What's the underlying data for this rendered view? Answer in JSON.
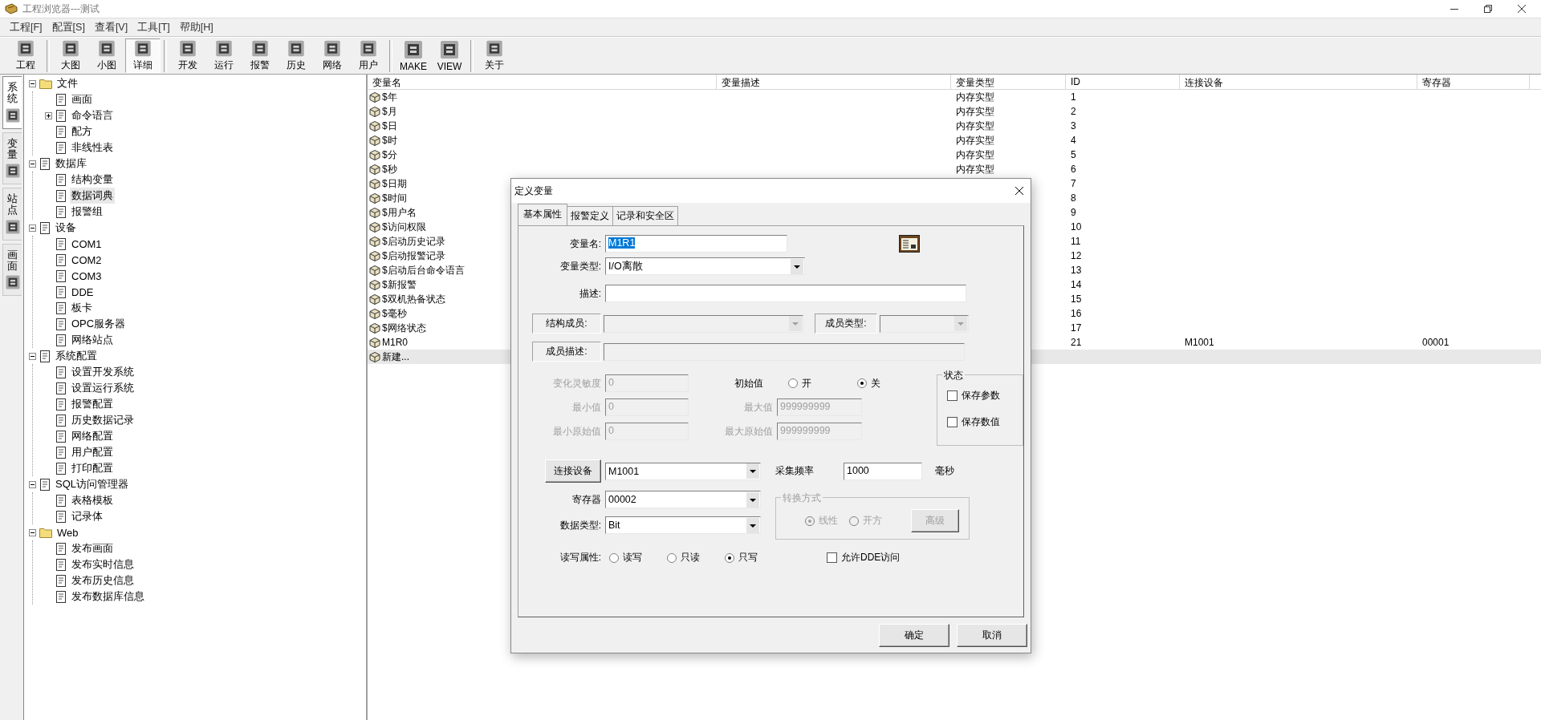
{
  "window": {
    "title": "工程浏览器---测试"
  },
  "menu": [
    "工程[F]",
    "配置[S]",
    "查看[V]",
    "工具[T]",
    "帮助[H]"
  ],
  "toolbar": {
    "groups": [
      [
        {
          "label": "工程",
          "selected": false
        }
      ],
      [
        {
          "label": "大图",
          "selected": false
        },
        {
          "label": "小图",
          "selected": false
        },
        {
          "label": "详细",
          "selected": true
        }
      ],
      [
        {
          "label": "开发",
          "selected": false
        },
        {
          "label": "运行",
          "selected": false
        },
        {
          "label": "报警",
          "selected": false
        },
        {
          "label": "历史",
          "selected": false
        },
        {
          "label": "网络",
          "selected": false
        },
        {
          "label": "用户",
          "selected": false
        }
      ],
      [
        {
          "label": "MAKE",
          "selected": false
        },
        {
          "label": "VIEW",
          "selected": false
        }
      ],
      [
        {
          "label": "关于",
          "selected": false
        }
      ]
    ]
  },
  "side_tabs": [
    {
      "label": "系统",
      "selected": true
    },
    {
      "label": "变量",
      "selected": false
    },
    {
      "label": "站点",
      "selected": false
    },
    {
      "label": "画面",
      "selected": false
    }
  ],
  "tree": [
    {
      "label": "文件",
      "kind": "folder",
      "expanded": true,
      "selected": false,
      "children": [
        {
          "label": "画面",
          "kind": "item",
          "selected": false
        },
        {
          "label": "命令语言",
          "kind": "item",
          "expanded": false,
          "selected": false
        },
        {
          "label": "配方",
          "kind": "item",
          "selected": false
        },
        {
          "label": "非线性表",
          "kind": "item",
          "selected": false
        }
      ]
    },
    {
      "label": "数据库",
      "kind": "item",
      "expanded": true,
      "selected": false,
      "children": [
        {
          "label": "结构变量",
          "kind": "item",
          "selected": false
        },
        {
          "label": "数据词典",
          "kind": "item",
          "selected": true
        },
        {
          "label": "报警组",
          "kind": "item",
          "selected": false
        }
      ]
    },
    {
      "label": "设备",
      "kind": "item",
      "expanded": true,
      "selected": false,
      "children": [
        {
          "label": "COM1",
          "kind": "item",
          "selected": false
        },
        {
          "label": "COM2",
          "kind": "item",
          "selected": false
        },
        {
          "label": "COM3",
          "kind": "item",
          "selected": false
        },
        {
          "label": "DDE",
          "kind": "item",
          "selected": false
        },
        {
          "label": "板卡",
          "kind": "item",
          "selected": false
        },
        {
          "label": "OPC服务器",
          "kind": "item",
          "selected": false
        },
        {
          "label": "网络站点",
          "kind": "item",
          "selected": false
        }
      ]
    },
    {
      "label": "系统配置",
      "kind": "item",
      "expanded": true,
      "selected": false,
      "children": [
        {
          "label": "设置开发系统",
          "kind": "item",
          "selected": false
        },
        {
          "label": "设置运行系统",
          "kind": "item",
          "selected": false
        },
        {
          "label": "报警配置",
          "kind": "item",
          "selected": false
        },
        {
          "label": "历史数据记录",
          "kind": "item",
          "selected": false
        },
        {
          "label": "网络配置",
          "kind": "item",
          "selected": false
        },
        {
          "label": "用户配置",
          "kind": "item",
          "selected": false
        },
        {
          "label": "打印配置",
          "kind": "item",
          "selected": false
        }
      ]
    },
    {
      "label": "SQL访问管理器",
      "kind": "item",
      "expanded": true,
      "selected": false,
      "children": [
        {
          "label": "表格模板",
          "kind": "item",
          "selected": false
        },
        {
          "label": "记录体",
          "kind": "item",
          "selected": false
        }
      ]
    },
    {
      "label": "Web",
      "kind": "folder",
      "expanded": true,
      "selected": false,
      "children": [
        {
          "label": "发布画面",
          "kind": "item",
          "selected": false
        },
        {
          "label": "发布实时信息",
          "kind": "item",
          "selected": false
        },
        {
          "label": "发布历史信息",
          "kind": "item",
          "selected": false
        },
        {
          "label": "发布数据库信息",
          "kind": "item",
          "selected": false
        }
      ]
    }
  ],
  "table": {
    "columns": [
      "变量名",
      "变量描述",
      "变量类型",
      "ID",
      "连接设备",
      "寄存器"
    ],
    "rows": [
      {
        "name": "$年",
        "type": "内存实型",
        "id": "1",
        "selected": false
      },
      {
        "name": "$月",
        "type": "内存实型",
        "id": "2",
        "selected": false
      },
      {
        "name": "$日",
        "type": "内存实型",
        "id": "3",
        "selected": false
      },
      {
        "name": "$时",
        "type": "内存实型",
        "id": "4",
        "selected": false
      },
      {
        "name": "$分",
        "type": "内存实型",
        "id": "5",
        "selected": false
      },
      {
        "name": "$秒",
        "type": "内存实型",
        "id": "6",
        "selected": false
      },
      {
        "name": "$日期",
        "id": "7",
        "selected": false
      },
      {
        "name": "$时间",
        "id": "8",
        "selected": false
      },
      {
        "name": "$用户名",
        "id": "9",
        "selected": false
      },
      {
        "name": "$访问权限",
        "id": "10",
        "selected": false
      },
      {
        "name": "$启动历史记录",
        "id": "11",
        "selected": false
      },
      {
        "name": "$启动报警记录",
        "id": "12",
        "selected": false
      },
      {
        "name": "$启动后台命令语言",
        "id": "13",
        "selected": false
      },
      {
        "name": "$新报警",
        "id": "14",
        "selected": false
      },
      {
        "name": "$双机热备状态",
        "id": "15",
        "selected": false
      },
      {
        "name": "$毫秒",
        "id": "16",
        "selected": false
      },
      {
        "name": "$网络状态",
        "id": "17",
        "selected": false
      },
      {
        "name": "M1R0",
        "id": "21",
        "device": "M1001",
        "register": "00001",
        "selected": false
      },
      {
        "name": "新建...",
        "selected": true
      }
    ]
  },
  "dialog": {
    "title": "定义变量",
    "tabs": [
      {
        "label": "基本属性",
        "selected": true
      },
      {
        "label": "报警定义",
        "selected": false
      },
      {
        "label": "记录和安全区",
        "selected": false
      }
    ],
    "fields": {
      "name": {
        "label": "变量名:",
        "value": "M1R1",
        "text_selected": true
      },
      "type": {
        "label": "变量类型:",
        "value": "I/O离散"
      },
      "description": {
        "label": "描述:"
      },
      "struct_member": {
        "label": "结构成员:",
        "disabled": true
      },
      "member_type": {
        "label": "成员类型:",
        "disabled": true
      },
      "member_description": {
        "label": "成员描述:",
        "disabled": true
      },
      "sensitivity": {
        "label": "变化灵敏度",
        "value": "0",
        "disabled": true
      },
      "min_value": {
        "label": "最小值",
        "value": "0",
        "disabled": true
      },
      "max_value": {
        "label": "最大值",
        "value": "999999999",
        "disabled": true
      },
      "min_raw": {
        "label": "最小原始值",
        "value": "0",
        "disabled": true
      },
      "max_raw": {
        "label": "最大原始值",
        "value": "999999999",
        "disabled": true
      },
      "initial_value": {
        "label": "初始值",
        "options": [
          {
            "label": "开",
            "selected": false
          },
          {
            "label": "关",
            "selected": true
          }
        ]
      },
      "status": {
        "title": "状态",
        "options": [
          {
            "label": "保存参数",
            "checked": false
          },
          {
            "label": "保存数值",
            "checked": false
          }
        ]
      },
      "device": {
        "button": "连接设备",
        "value": "M1001"
      },
      "rate": {
        "label": "采集频率",
        "value": "1000",
        "unit": "毫秒"
      },
      "register": {
        "label": "寄存器",
        "value": "00002"
      },
      "conversion": {
        "title": "转换方式",
        "disabled": true,
        "options": [
          {
            "label": "线性",
            "selected": true
          },
          {
            "label": "开方",
            "selected": false
          }
        ],
        "button": "高级"
      },
      "data_type": {
        "label": "数据类型:",
        "value": "Bit"
      },
      "access": {
        "label": "读写属性:",
        "options": [
          {
            "label": "读写",
            "selected": false
          },
          {
            "label": "只读",
            "selected": false
          },
          {
            "label": "只写",
            "selected": true
          }
        ]
      },
      "dde": {
        "label": "允许DDE访问",
        "checked": false
      }
    },
    "buttons": [
      "确定",
      "取消"
    ]
  }
}
